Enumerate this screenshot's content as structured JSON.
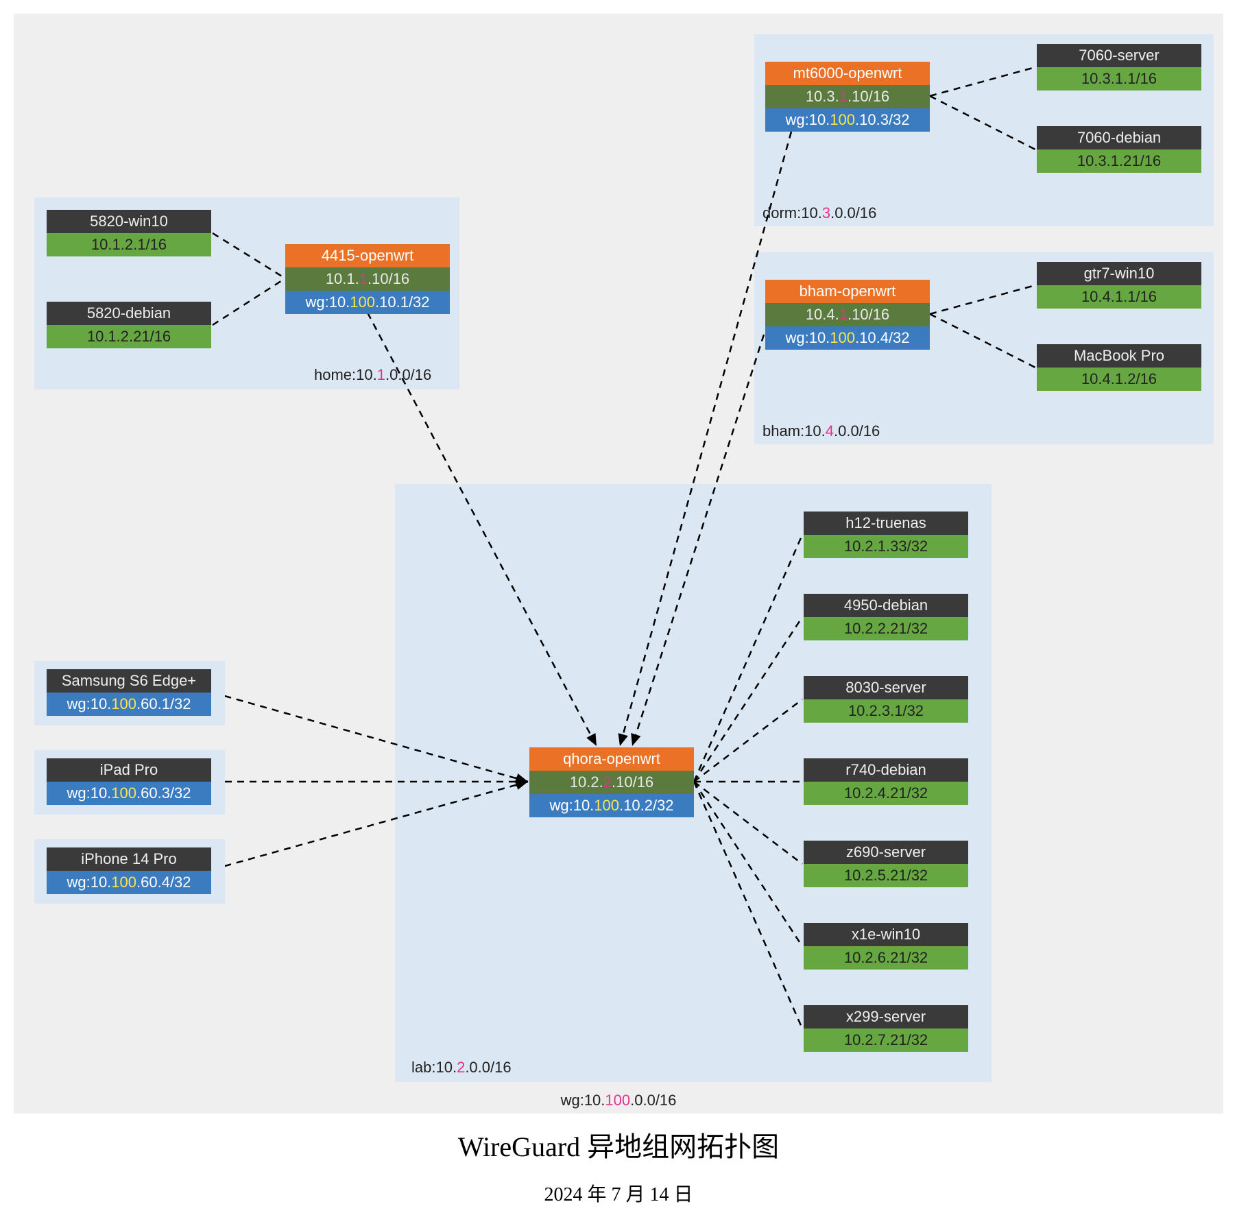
{
  "title": "WireGuard 异地组网拓扑图",
  "date": "2024 年 7 月 14 日",
  "wg_global_caption_html": "wg:10.<span class='hl'>100</span>.0.0/16",
  "subnets": {
    "home": {
      "caption_html": "home:10.<span class='hl'>1</span>.0.0/16"
    },
    "dorm": {
      "caption_html": "dorm:10.<span class='hl'>3</span>.0.0/16"
    },
    "bham": {
      "caption_html": "bham:10.<span class='hl'>4</span>.0.0/16"
    },
    "lab": {
      "caption_html": "lab:10.<span class='hl'>2</span>.0.0/16"
    }
  },
  "nodes": {
    "5820_win10": {
      "name": "5820-win10",
      "ip": "10.1.2.1/16"
    },
    "5820_debian": {
      "name": "5820-debian",
      "ip": "10.1.2.21/16"
    },
    "4415_openwrt": {
      "name": "4415-openwrt",
      "ip_html": "10.1.<span class='hl'>1</span>.10/16",
      "wg_html": "wg:10.<span class='hl'>100</span>.10.1/32"
    },
    "mt6000_openwrt": {
      "name": "mt6000-openwrt",
      "ip_html": "10.3.<span class='hl'>1</span>.10/16",
      "wg_html": "wg:10.<span class='hl'>100</span>.10.3/32"
    },
    "7060_server": {
      "name": "7060-server",
      "ip": "10.3.1.1/16"
    },
    "7060_debian": {
      "name": "7060-debian",
      "ip": "10.3.1.21/16"
    },
    "bham_openwrt": {
      "name": "bham-openwrt",
      "ip_html": "10.4.<span class='hl'>1</span>.10/16",
      "wg_html": "wg:10.<span class='hl'>100</span>.10.4/32"
    },
    "gtr7_win10": {
      "name": "gtr7-win10",
      "ip": "10.4.1.1/16"
    },
    "macbook_pro": {
      "name": "MacBook Pro",
      "ip": "10.4.1.2/16"
    },
    "qhora_openwrt": {
      "name": "qhora-openwrt",
      "ip_html": "10.2.<span class='hl'>2</span>.10/16",
      "wg_html": "wg:10.<span class='hl'>100</span>.10.2/32"
    },
    "h12_truenas": {
      "name": "h12-truenas",
      "ip": "10.2.1.33/32"
    },
    "4950_debian": {
      "name": "4950-debian",
      "ip": "10.2.2.21/32"
    },
    "8030_server": {
      "name": "8030-server",
      "ip": "10.2.3.1/32"
    },
    "r740_debian": {
      "name": "r740-debian",
      "ip": "10.2.4.21/32"
    },
    "z690_server": {
      "name": "z690-server",
      "ip": "10.2.5.21/32"
    },
    "x1e_win10": {
      "name": "x1e-win10",
      "ip": "10.2.6.21/32"
    },
    "x299_server": {
      "name": "x299-server",
      "ip": "10.2.7.21/32"
    },
    "samsung_s6": {
      "name": "Samsung S6 Edge+",
      "wg_html": "wg:10.<span class='hl'>100</span>.60.1/32"
    },
    "ipad_pro": {
      "name": "iPad Pro",
      "wg_html": "wg:10.<span class='hl'>100</span>.60.3/32"
    },
    "iphone14": {
      "name": "iPhone 14 Pro",
      "wg_html": "wg:10.<span class='hl'>100</span>.60.4/32"
    }
  }
}
